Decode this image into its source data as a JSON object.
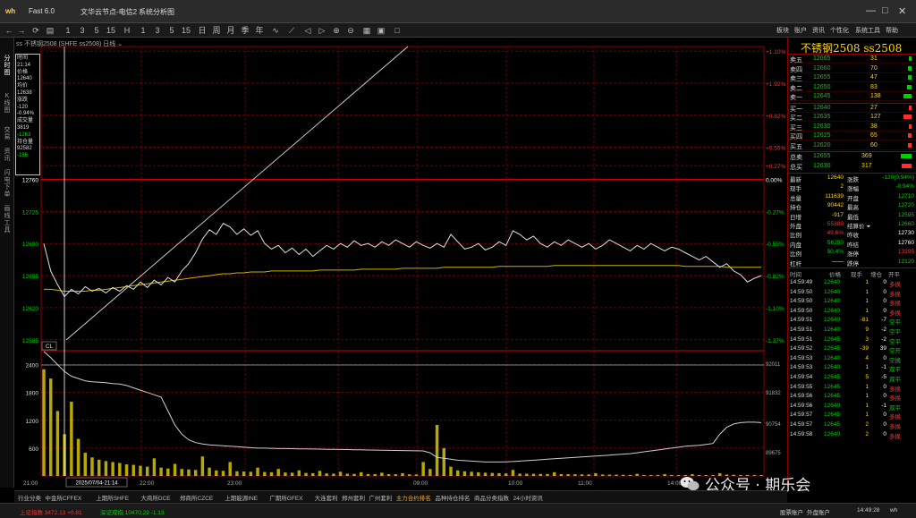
{
  "window": {
    "app_name": "Fast 6.0",
    "node": "文华云节点-电信2",
    "system": "系统分析图",
    "controls": [
      "—",
      "□",
      "✕"
    ]
  },
  "toolbar": {
    "right_menu": [
      "板块",
      "账户",
      "资讯",
      "个性化",
      "系统工具",
      "帮助"
    ]
  },
  "left_rail": [
    "分时图",
    "K线图",
    "交易",
    "资讯",
    "闪电下单",
    "画线工具"
  ],
  "chart_header": "ss 不锈钢2508 (SHFE ss2508)  日线 ⌄",
  "infobox": [
    {
      "text": "时间",
      "color": "#ddd"
    },
    {
      "text": "21:14",
      "color": "#ddd"
    },
    {
      "text": "价格",
      "color": "#ddd"
    },
    {
      "text": "12640",
      "color": "#ddd"
    },
    {
      "text": "均价",
      "color": "#ddd"
    },
    {
      "text": "12638",
      "color": "#ddd"
    },
    {
      "text": "涨跌",
      "color": "#ddd"
    },
    {
      "text": "-120",
      "color": "#ddd"
    },
    {
      "text": "-0.94%",
      "color": "#ddd"
    },
    {
      "text": "成交量",
      "color": "#ddd"
    },
    {
      "text": "3819",
      "color": "#ddd"
    },
    {
      "text": "-1263",
      "color": "#00e000"
    },
    {
      "text": "持仓量",
      "color": "#ddd"
    },
    {
      "text": "92582",
      "color": "#ddd"
    },
    {
      "text": "-186",
      "color": "#00e000"
    }
  ],
  "chart_data": {
    "type": "line",
    "y_price_labels": [
      {
        "value": 12760,
        "label": "12760"
      },
      {
        "value": 12725,
        "label": "12725"
      },
      {
        "value": 12690,
        "label": "12690"
      },
      {
        "value": 12655,
        "label": "12655"
      },
      {
        "value": 12620,
        "label": "12620"
      },
      {
        "value": 12585,
        "label": "12585"
      }
    ],
    "y_pct_labels": [
      {
        "value": 12900,
        "label": "+1.10%"
      },
      {
        "value": 12865,
        "label": "+1.92%"
      },
      {
        "value": 12830,
        "label": "+0.82%"
      },
      {
        "value": 12795,
        "label": "+0.55%"
      },
      {
        "value": 12775,
        "label": "+0.27%"
      },
      {
        "value": 12760,
        "label": "0.00%"
      },
      {
        "value": 12725,
        "label": "-0.27%"
      },
      {
        "value": 12690,
        "label": "-0.55%"
      },
      {
        "value": 12655,
        "label": "-0.82%"
      },
      {
        "value": 12620,
        "label": "-1.10%"
      },
      {
        "value": 12585,
        "label": "-1.37%"
      }
    ],
    "price_ylim": [
      12575,
      12905
    ],
    "ref_price": 12760,
    "vol_ylabels": [
      {
        "value": 2400,
        "label": "2400"
      },
      {
        "value": 1800,
        "label": "1800"
      },
      {
        "value": 1200,
        "label": "1200"
      },
      {
        "value": 600,
        "label": "600"
      }
    ],
    "oi_ylabels": [
      "92011",
      "91832",
      "90754",
      "89675"
    ],
    "vol_ylim": [
      0,
      2700
    ],
    "x_labels": [
      "21:00",
      "2025/07/04-21:14",
      "22:00",
      "23:00",
      "09:00",
      "10:00",
      "11:00",
      "14:00"
    ],
    "crosshair_label": "CL",
    "price": [
      12690,
      12660,
      12645,
      12632,
      12640,
      12635,
      12643,
      12638,
      12641,
      12636,
      12642,
      12638,
      12644,
      12640,
      12648,
      12642,
      12650,
      12645,
      12653,
      12648,
      12660,
      12668,
      12680,
      12695,
      12705,
      12700,
      12712,
      12708,
      12700,
      12706,
      12699,
      12704,
      12690,
      12684,
      12688,
      12680,
      12685,
      12678,
      12684,
      12676,
      12682,
      12688,
      12684,
      12690,
      12686,
      12693,
      12688,
      12690,
      12686,
      12692,
      12688,
      12694,
      12690,
      12686,
      12692,
      12688,
      12685,
      12690,
      12686,
      12700,
      12692,
      12684,
      12686,
      12690,
      12683,
      12686,
      12692,
      12688,
      12704,
      12700,
      12694,
      12698,
      12690,
      12686,
      12692,
      12688,
      12694,
      12690,
      12686,
      12690,
      12684,
      12688,
      12694,
      12690,
      12686,
      12682,
      12688,
      12684,
      12690,
      12686,
      12682,
      12686,
      12684,
      12680,
      12676,
      12672,
      12676,
      12670,
      12664,
      12668,
      12660,
      12656,
      12648,
      12652,
      12655
    ],
    "avg": [
      12640,
      12640,
      12639,
      12638,
      12638,
      12638,
      12638,
      12639,
      12639,
      12640,
      12641,
      12642,
      12643,
      12644,
      12645,
      12646,
      12647,
      12648,
      12649,
      12650,
      12651,
      12652,
      12653,
      12654,
      12655,
      12656,
      12657,
      12657,
      12658,
      12658,
      12659,
      12659,
      12659,
      12660,
      12660,
      12660,
      12660,
      12660,
      12660,
      12660,
      12661,
      12661,
      12661,
      12661,
      12661,
      12661,
      12662,
      12662,
      12662,
      12662,
      12662,
      12662,
      12663,
      12663,
      12663,
      12663,
      12663,
      12663,
      12664,
      12664,
      12664,
      12664,
      12664,
      12664,
      12664,
      12664,
      12665,
      12665,
      12665,
      12665,
      12665,
      12665,
      12665,
      12665,
      12666,
      12666,
      12666,
      12666,
      12666,
      12666,
      12666,
      12666,
      12666,
      12666,
      12666,
      12666,
      12666,
      12666,
      12666,
      12666,
      12666,
      12666,
      12666,
      12665,
      12665,
      12665,
      12665,
      12665,
      12665,
      12664,
      12664,
      12664,
      12664,
      12664,
      12664
    ],
    "open_interest": [
      2680,
      2550,
      2400,
      2250,
      2150,
      2100,
      2050,
      2030,
      2020,
      2010,
      1990,
      1980,
      1950,
      1900,
      1850,
      1800,
      1750,
      1700,
      1400,
      1100,
      900,
      780,
      720,
      690,
      670,
      660,
      650,
      640,
      630,
      620,
      610,
      600,
      600,
      595,
      590,
      590,
      588,
      585,
      583,
      580,
      578,
      575,
      572,
      570,
      568,
      565,
      563,
      560,
      558,
      555,
      552,
      550,
      548,
      545,
      542,
      540,
      500,
      400,
      380,
      360,
      340,
      330,
      320,
      310,
      300,
      300,
      300,
      305,
      310,
      320,
      330,
      340,
      350,
      360,
      370,
      380,
      390,
      400,
      410,
      420,
      430,
      440,
      450,
      460,
      470,
      480,
      500,
      520,
      540,
      560,
      580,
      600,
      620,
      640,
      650,
      660,
      680,
      700,
      900,
      1050,
      1120,
      1150,
      1160,
      1160,
      1150
    ],
    "volume": [
      2300,
      2100,
      1400,
      900,
      1600,
      800,
      500,
      400,
      350,
      320,
      300,
      280,
      250,
      240,
      220,
      200,
      380,
      180,
      160,
      260,
      150,
      140,
      130,
      420,
      180,
      120,
      110,
      300,
      100,
      95,
      90,
      180,
      85,
      80,
      150,
      75,
      70,
      120,
      65,
      60,
      110,
      55,
      50,
      90,
      48,
      45,
      80,
      42,
      40,
      70,
      38,
      36,
      60,
      34,
      32,
      300,
      150,
      1100,
      600,
      200,
      120,
      100,
      90,
      80,
      70,
      65,
      60,
      55,
      130,
      50,
      48,
      46,
      44,
      42,
      80,
      40,
      38,
      36,
      34,
      32,
      60,
      30,
      28,
      26,
      24,
      22,
      45,
      20,
      20,
      20,
      40,
      20,
      20,
      20,
      38,
      20,
      20,
      20,
      60,
      30,
      25,
      20,
      20,
      20,
      20
    ]
  },
  "right_panel": {
    "title": "不锈钢2508  ss2508",
    "asks": [
      {
        "name": "卖五",
        "price": "12665",
        "qty": "31",
        "bar": 3
      },
      {
        "name": "卖四",
        "price": "12660",
        "qty": "70",
        "bar": 4
      },
      {
        "name": "卖三",
        "price": "12655",
        "qty": "47",
        "bar": 4
      },
      {
        "name": "卖二",
        "price": "12650",
        "qty": "83",
        "bar": 5
      },
      {
        "name": "卖一",
        "price": "12645",
        "qty": "138",
        "bar": 9
      }
    ],
    "bids": [
      {
        "name": "买一",
        "price": "12640",
        "qty": "27",
        "bar": 3
      },
      {
        "name": "买二",
        "price": "12635",
        "qty": "127",
        "bar": 9
      },
      {
        "name": "买三",
        "price": "12630",
        "qty": "38",
        "bar": 3
      },
      {
        "name": "买四",
        "price": "12625",
        "qty": "65",
        "bar": 4
      },
      {
        "name": "买五",
        "price": "12620",
        "qty": "60",
        "bar": 4
      }
    ],
    "totals": [
      {
        "name": "总卖",
        "price": "12655",
        "qty": "369",
        "bar": 12,
        "color": "#00d000"
      },
      {
        "name": "总买",
        "price": "12630",
        "qty": "317",
        "bar": 11,
        "color": "#ff3030"
      }
    ],
    "stats": [
      {
        "l1": "最新",
        "v1": "12640",
        "c1": "#ffd700",
        "l2": "涨跌",
        "v2": "-120(0.94%)",
        "c2": "#00d000"
      },
      {
        "l1": "现手",
        "v1": "2",
        "c1": "#ffd700",
        "l2": "涨幅",
        "v2": "-0.94%",
        "c2": "#00d000"
      },
      {
        "l1": "总量",
        "v1": "111639",
        "c1": "#ffd700",
        "l2": "开盘",
        "v2": "12710",
        "c2": "#00d000"
      },
      {
        "l1": "持仓",
        "v1": "90442",
        "c1": "#ffd700",
        "l2": "最高",
        "v2": "12720",
        "c2": "#00d000"
      },
      {
        "l1": "日增",
        "v1": "-917",
        "c1": "#ffd700",
        "l2": "最低",
        "v2": "12595",
        "c2": "#00d000"
      },
      {
        "l1": "外盘",
        "v1": "55389",
        "c1": "#ff3030",
        "l2": "结算价 ⏷",
        "v2": "12660",
        "c2": "#00d000"
      },
      {
        "l1": "比例",
        "v1": "49.6%",
        "c1": "#ff3030",
        "l2": "昨收",
        "v2": "12730",
        "c2": "#ffffff"
      },
      {
        "l1": "内盘",
        "v1": "56250",
        "c1": "#00d000",
        "l2": "昨结",
        "v2": "12760",
        "c2": "#ffffff"
      },
      {
        "l1": "比例",
        "v1": "50.4%",
        "c1": "#00d000",
        "l2": "涨停",
        "v2": "13395",
        "c2": "#ff3030"
      },
      {
        "l1": "杠杆",
        "v1": "——",
        "c1": "#ffffff",
        "l2": "跌停",
        "v2": "12120",
        "c2": "#00d000"
      }
    ],
    "ticks_header": [
      "时间",
      "价格",
      "现手",
      "增仓",
      "开平"
    ],
    "ticks": [
      {
        "t": "14:59:49",
        "p": "12640",
        "v": "1",
        "d": "0",
        "k": "多换",
        "pc": "#00d000",
        "kc": "#ff3030"
      },
      {
        "t": "14:59:50",
        "p": "12640",
        "v": "1",
        "d": "0",
        "k": "多换",
        "pc": "#00d000",
        "kc": "#ff3030"
      },
      {
        "t": "14:59:50",
        "p": "12640",
        "v": "1",
        "d": "0",
        "k": "多换",
        "pc": "#00d000",
        "kc": "#ff3030"
      },
      {
        "t": "14:59:50",
        "p": "12640",
        "v": "1",
        "d": "0",
        "k": "多换",
        "pc": "#00d000",
        "kc": "#ff3030"
      },
      {
        "t": "14:59:51",
        "p": "12640",
        "v": "-81",
        "d": "-7",
        "k": "空平",
        "pc": "#00d000",
        "kc": "#00d000"
      },
      {
        "t": "14:59:51",
        "p": "12640",
        "v": "9",
        "d": "-2",
        "k": "空平",
        "pc": "#00d000",
        "kc": "#00d000"
      },
      {
        "t": "14:59:51",
        "p": "12645",
        "v": "3",
        "d": "-2",
        "k": "空平",
        "pc": "#00d000",
        "kc": "#00d000"
      },
      {
        "t": "14:59:52",
        "p": "12645",
        "v": "-39",
        "d": "39",
        "k": "空开",
        "pc": "#00d000",
        "kc": "#00d000"
      },
      {
        "t": "14:59:53",
        "p": "12640",
        "v": "4",
        "d": "0",
        "k": "空换",
        "pc": "#00d000",
        "kc": "#00d000"
      },
      {
        "t": "14:59:53",
        "p": "12640",
        "v": "1",
        "d": "-1",
        "k": "双平",
        "pc": "#00d000",
        "kc": "#00d000"
      },
      {
        "t": "14:59:54",
        "p": "12645",
        "v": "5",
        "d": "-5",
        "k": "双平",
        "pc": "#00d000",
        "kc": "#00d000"
      },
      {
        "t": "14:59:55",
        "p": "12645",
        "v": "1",
        "d": "0",
        "k": "多换",
        "pc": "#00d000",
        "kc": "#ff3030"
      },
      {
        "t": "14:59:56",
        "p": "12645",
        "v": "1",
        "d": "0",
        "k": "多换",
        "pc": "#00d000",
        "kc": "#ff3030"
      },
      {
        "t": "14:59:56",
        "p": "12640",
        "v": "1",
        "d": "-1",
        "k": "双平",
        "pc": "#00d000",
        "kc": "#00d000"
      },
      {
        "t": "14:59:57",
        "p": "12645",
        "v": "1",
        "d": "0",
        "k": "多换",
        "pc": "#00d000",
        "kc": "#ff3030"
      },
      {
        "t": "14:59:57",
        "p": "12645",
        "v": "2",
        "d": "0",
        "k": "多换",
        "pc": "#00d000",
        "kc": "#ff3030"
      },
      {
        "t": "14:59:58",
        "p": "12640",
        "v": "2",
        "d": "0",
        "k": "多换",
        "pc": "#00d000",
        "kc": "#ff3030"
      }
    ]
  },
  "bottom_tabs": [
    "行业分类",
    "中金所CFFEX",
    "上期所SHFE",
    "大商所DCE",
    "郑商所CZCE",
    "上期能源INE",
    "广期所GFEX",
    "大连套利",
    "郑州套利",
    "广州套利",
    "主力合约排名",
    "品种持仓排名",
    "商品分类指数",
    "24小时资讯"
  ],
  "active_tab": "主力合约排名",
  "status": {
    "sh_index": "上证指数 3472.13 +0.81",
    "sz_index": "深证成指 10470.29 -1.13",
    "right": [
      "股票账户",
      "外盘账户",
      "14:49:28",
      "wh"
    ]
  },
  "watermark": "公众号 · 期乐会",
  "colors": {
    "grid_red": "#8b0000",
    "grid_line": "#b00000",
    "price_line": "#e0e0e0",
    "avg_line": "#c8b400",
    "volume_bar": "#b8a800",
    "gold": "#ffd700",
    "up": "#ff3030",
    "down": "#00d000"
  }
}
